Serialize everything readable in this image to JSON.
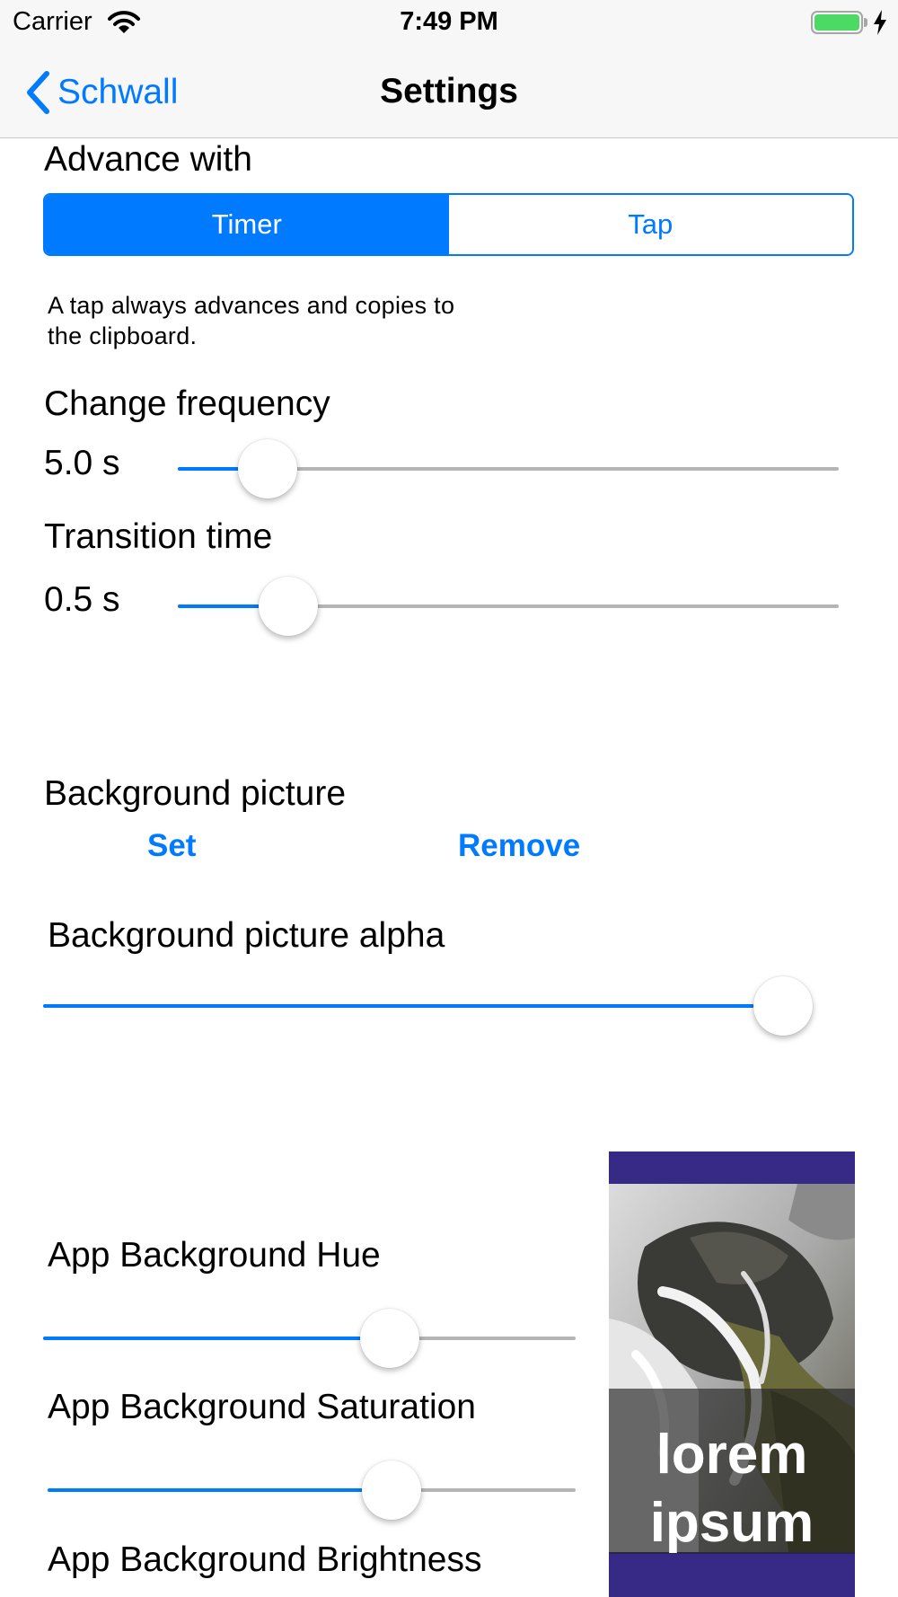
{
  "status_bar": {
    "carrier": "Carrier",
    "time": "7:49 PM",
    "icons": [
      "wifi-icon",
      "battery-icon",
      "charging-bolt-icon"
    ],
    "battery_level": 1.0,
    "battery_color": "#4cd964"
  },
  "nav": {
    "back_label": "Schwall",
    "back_icon": "chevron-left-icon",
    "title": "Settings"
  },
  "advance": {
    "label": "Advance with",
    "options": [
      "Timer",
      "Tap"
    ],
    "selected": "Timer",
    "note_line1": "A tap always advances and copies to",
    "note_line2": "the clipboard."
  },
  "change_frequency": {
    "label": "Change frequency",
    "value_text": "5.0 s",
    "position": 0.1
  },
  "transition_time": {
    "label": "Transition time",
    "value_text": "0.5 s",
    "position": 0.135
  },
  "background_picture": {
    "label": "Background picture",
    "set_label": "Set",
    "remove_label": "Remove"
  },
  "background_alpha": {
    "label": "Background picture alpha",
    "position": 1.0
  },
  "app_background": {
    "hue_label": "App Background Hue",
    "hue_position": 0.67,
    "saturation_label": "App Background Saturation",
    "saturation_position": 0.67,
    "brightness_label": "App Background Brightness"
  },
  "preview": {
    "line1": "lorem",
    "line2": "ipsum",
    "background_color": "#372a86"
  },
  "colors": {
    "accent": "#007aff",
    "track": "#b5b5b5",
    "bar_background": "#f7f7f7"
  }
}
